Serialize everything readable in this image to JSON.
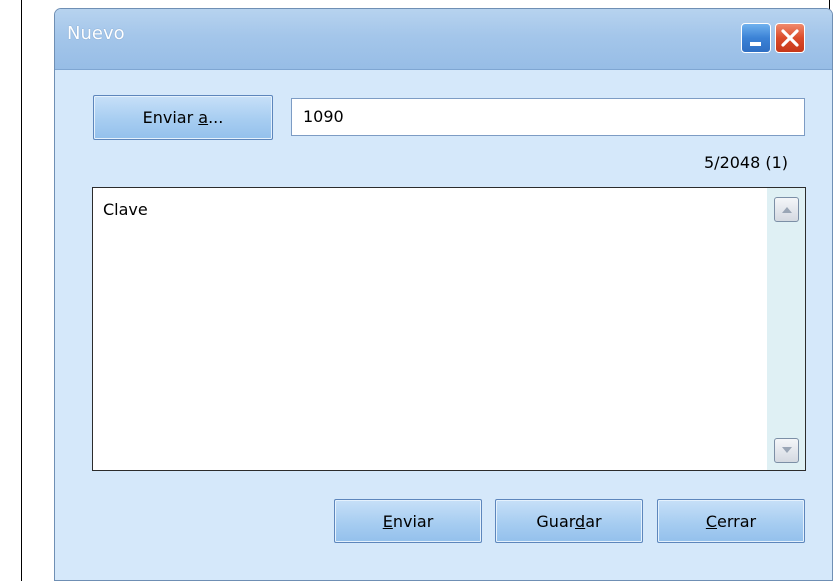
{
  "window": {
    "title": "Nuevo"
  },
  "recipient": {
    "button_label_prefix": "Enviar ",
    "button_label_mnemonic": "a",
    "button_label_suffix": "...",
    "value": "1090"
  },
  "message": {
    "counter": "5/2048 (1)",
    "body": "Clave"
  },
  "actions": {
    "send": {
      "mnemonic": "E",
      "rest": "nviar"
    },
    "save": {
      "prefix": "Guar",
      "mnemonic": "d",
      "rest": "ar"
    },
    "close": {
      "mnemonic": "C",
      "rest": "errar"
    }
  },
  "icons": {
    "minimize": "minimize-icon",
    "close": "close-icon",
    "scroll_up": "arrow-up-icon",
    "scroll_down": "arrow-down-icon"
  },
  "colors": {
    "dialog_bg": "#d5e8fa",
    "close_button": "#db4b2a",
    "minimize_button": "#3b82d6"
  }
}
